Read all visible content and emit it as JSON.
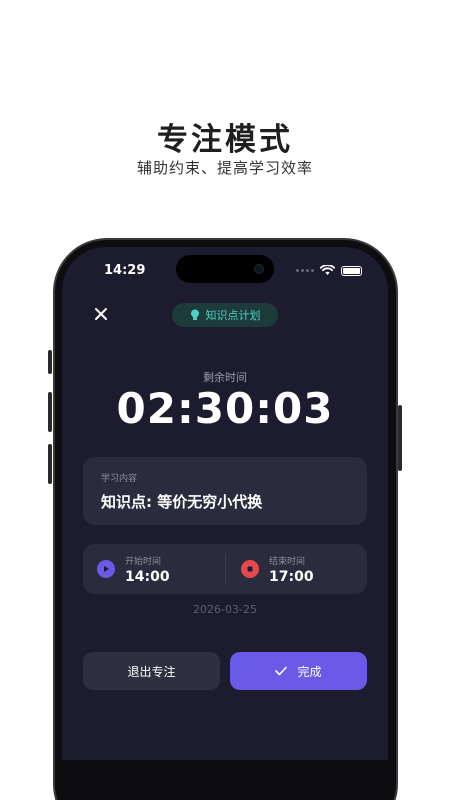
{
  "promo": {
    "title": "专注模式",
    "subtitle": "辅助约束、提高学习效率"
  },
  "status_bar": {
    "time": "14:29",
    "icons": [
      "signal-dots-icon",
      "wifi-icon",
      "battery-icon"
    ]
  },
  "header": {
    "close_icon": "close-icon",
    "plan_label": "知识点计划",
    "plan_icon": "lightbulb-icon"
  },
  "timer": {
    "label": "剩余时间",
    "value": "02:30:03"
  },
  "content": {
    "label": "学习内容",
    "value": "知识点: 等价无穷小代换"
  },
  "schedule": {
    "start_label": "开始时间",
    "start_time": "14:00",
    "end_label": "结束时间",
    "end_time": "17:00",
    "date": "2026-03-25"
  },
  "actions": {
    "exit_label": "退出专注",
    "done_label": "完成"
  },
  "colors": {
    "screen_bg": "#1c1c2e",
    "card_bg": "#2a2b3c",
    "accent": "#6a5ae8",
    "plan_teal": "#4fd1c5",
    "start_icon": "#6a5ae8",
    "end_icon": "#e5484d"
  }
}
